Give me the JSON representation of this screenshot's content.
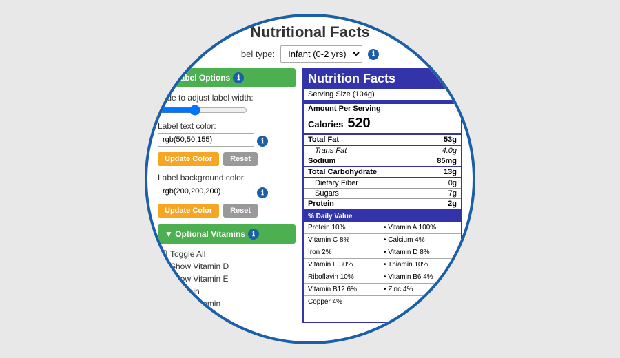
{
  "title": "Nutritional Facts",
  "labelType": {
    "label": "bel type:",
    "value": "Infant (0-2 yrs)"
  },
  "leftPanel": {
    "labelOptions": "▼ Label Options",
    "labelOptionsInfo": "ℹ",
    "slideLabel": "Slide to adjust label width:",
    "textColorLabel": "Label text color:",
    "textColorValue": "rgb(50,50,155)",
    "bgColorLabel": "Label background color:",
    "bgColorValue": "rgb(200,200,200)",
    "updateColorBtn": "Update Color",
    "resetBtn": "Reset",
    "optionalVitamins": "▼ Optional Vitamins",
    "optionalVitaminsInfo": "ℹ",
    "toggleAll": "Toggle All",
    "showVitaminD": "Show Vitamin D",
    "showVitaminE": "Show Vitamin E",
    "showThiamin": "Thiamin",
    "showVitamin": "Show Vitamin"
  },
  "nutritionFacts": {
    "title": "Nutrition Facts",
    "servingSize": "Serving Size (104g)",
    "amountPerServing": "Amount Per Serving",
    "calories": "Calories",
    "caloriesVal": "520",
    "totalFat": "Total Fat",
    "totalFatVal": "53g",
    "transFat": "Trans Fat",
    "transFatVal": "4.0g",
    "sodium": "Sodium",
    "sodiumVal": "85mg",
    "totalCarb": "Total Carbohydrate",
    "totalCarbVal": "13g",
    "dietaryFiber": "Dietary Fiber",
    "dietaryFiberVal": "0g",
    "sugars": "Sugars",
    "sugarsVal": "7g",
    "protein": "Protein",
    "proteinVal": "2g",
    "dailyValue": "% Daily Value",
    "dvRows": [
      [
        "Protein 10%",
        "• Vitamin A 100%"
      ],
      [
        "Vitamin C 8%",
        "• Calcium 4%"
      ],
      [
        "Iron 2%",
        "• Vitamin D 8%"
      ],
      [
        "Vitamin E 30%",
        "• Thiamin 10%"
      ],
      [
        "Riboflavin 10%",
        "• Vitamin B6 4%"
      ],
      [
        "Vitamin B12 6%",
        "• Zinc 4%"
      ],
      [
        "Copper 4%",
        ""
      ]
    ]
  }
}
